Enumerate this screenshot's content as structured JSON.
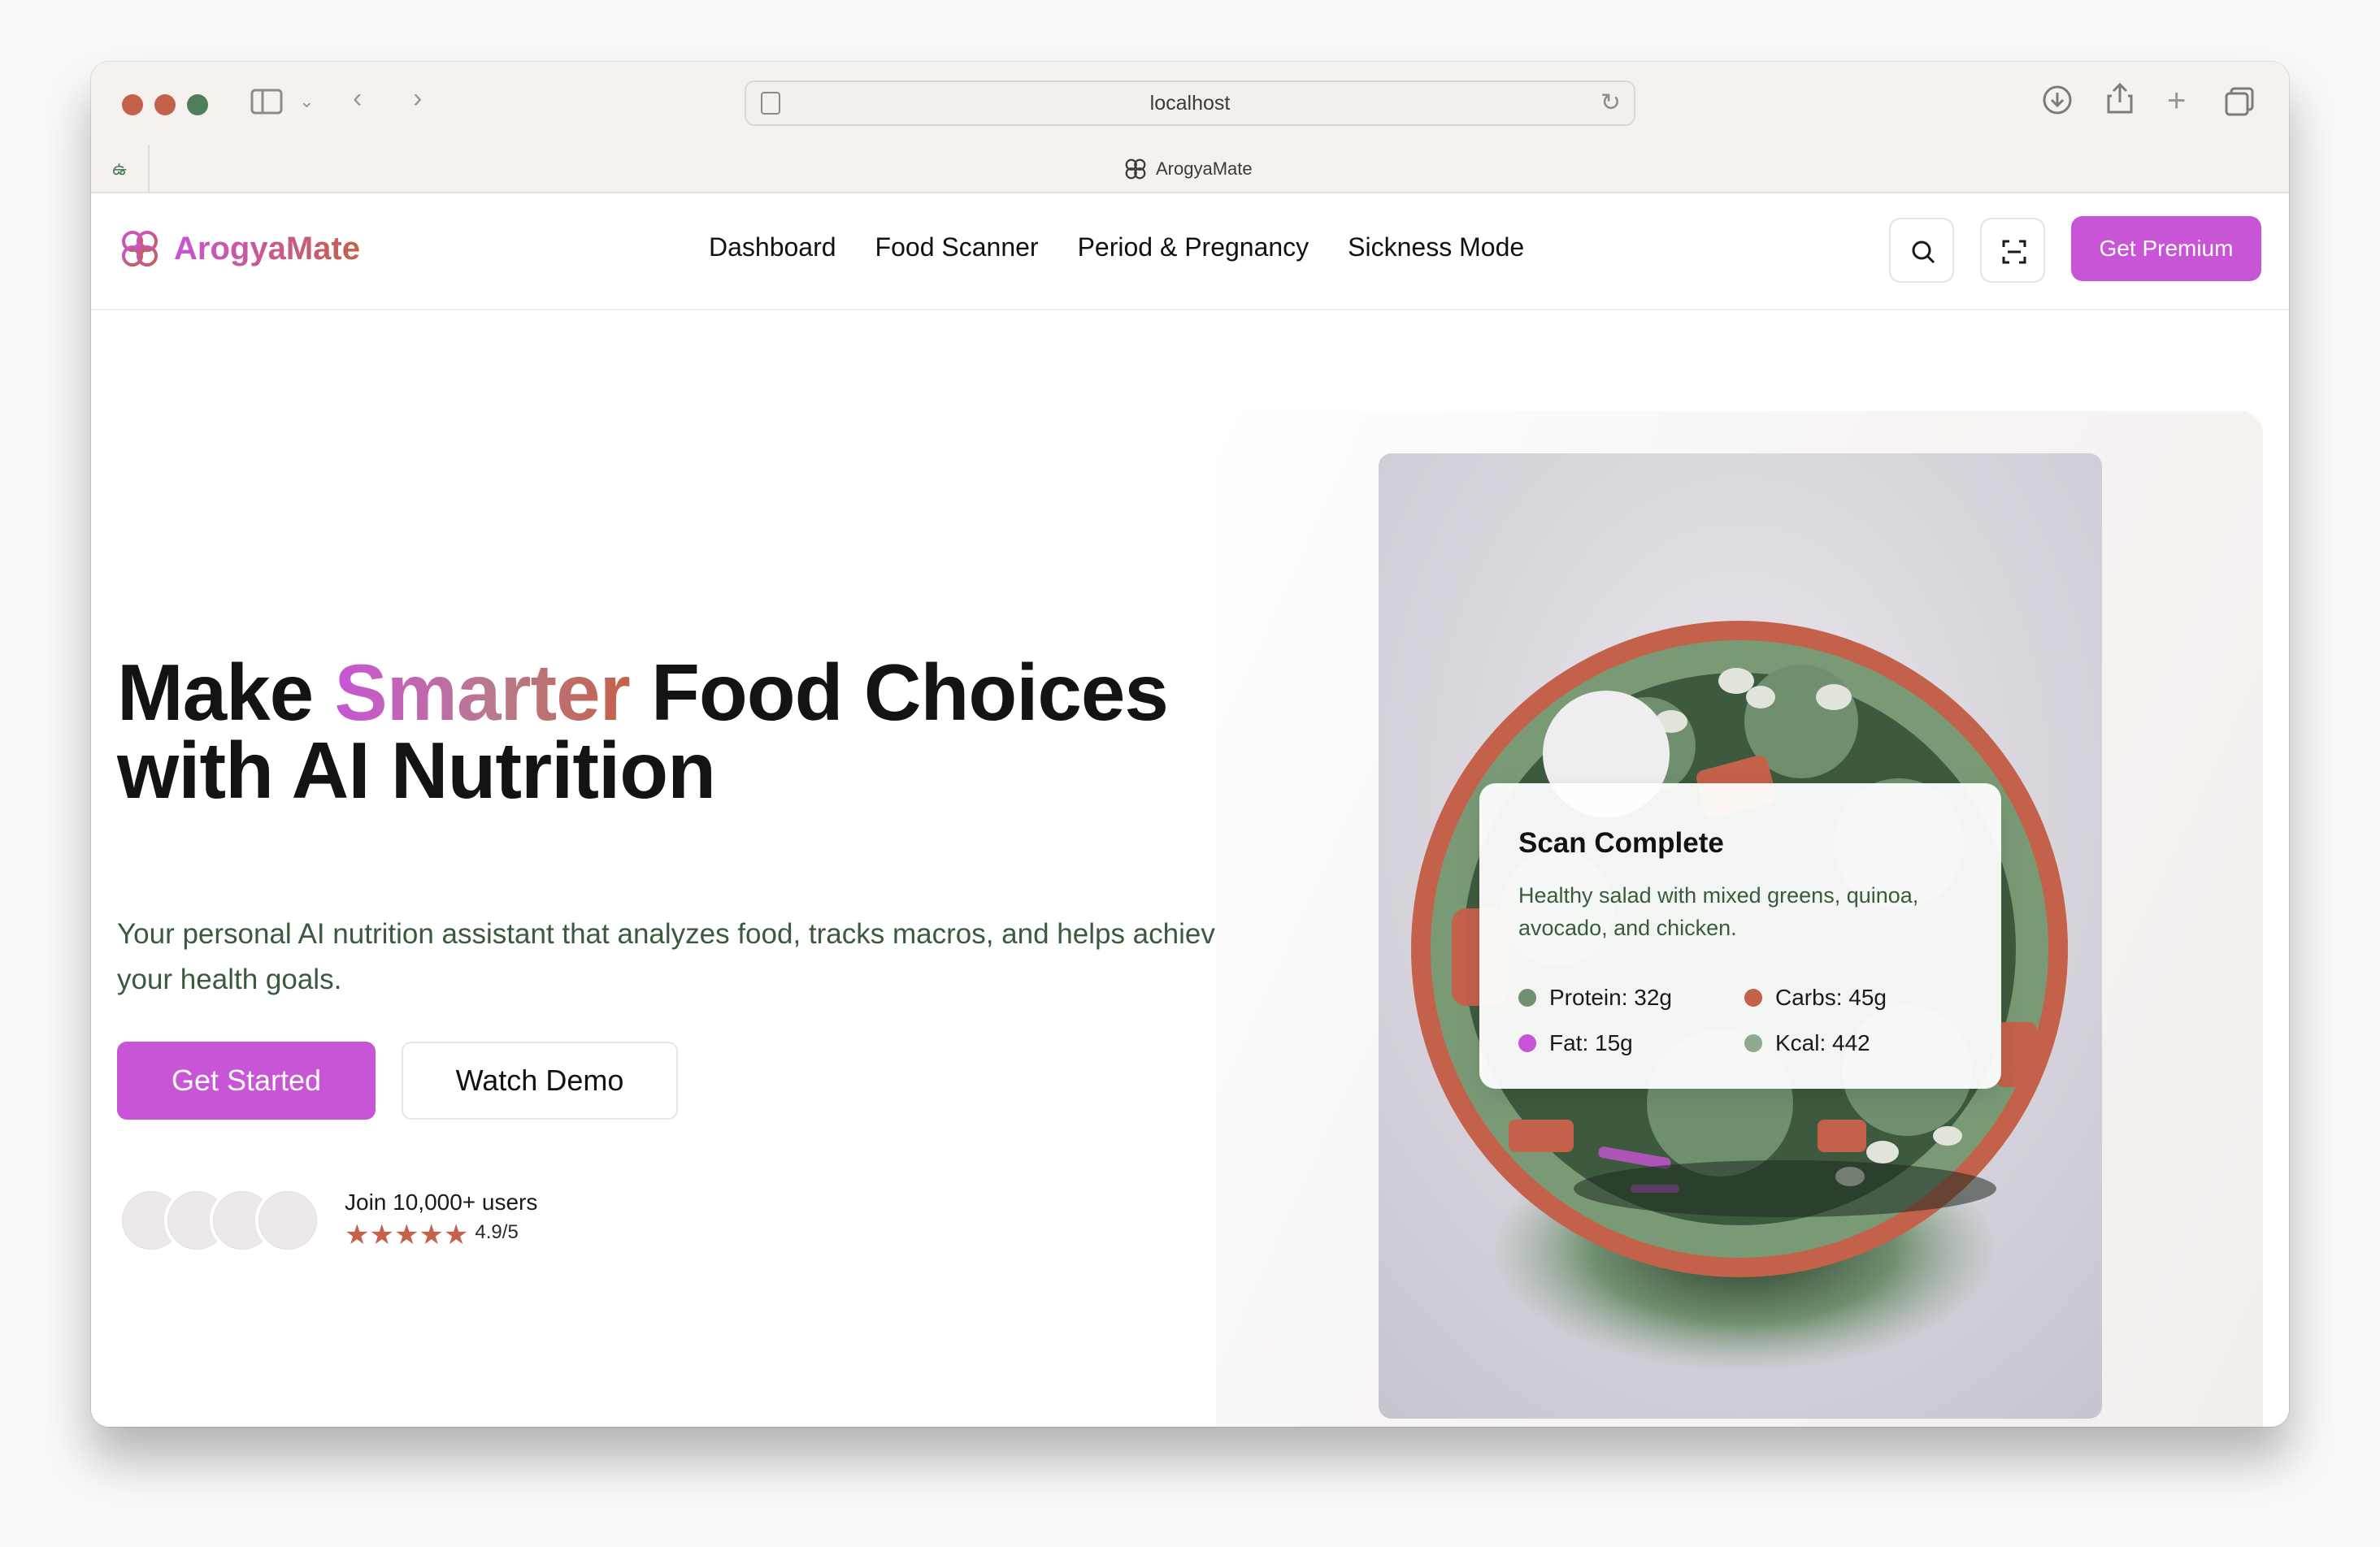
{
  "browser": {
    "url": "localhost",
    "tab_title": "ArogyaMate"
  },
  "header": {
    "brand": "ArogyaMate",
    "nav": [
      "Dashboard",
      "Food Scanner",
      "Period & Pregnancy",
      "Sickness Mode"
    ],
    "premium_label": "Get Premium",
    "icons": [
      "search-icon",
      "scan-icon"
    ]
  },
  "hero": {
    "title_part1": "Make ",
    "title_highlight": "Smarter",
    "title_part2": " Food Choices",
    "title_line2": "with AI Nutrition",
    "subtitle": "Your personal AI nutrition assistant that analyzes food, tracks macros, and helps achieve your health goals.",
    "primary_cta": "Get Started",
    "secondary_cta": "Watch Demo",
    "social_proof": "Join 10,000+ users",
    "rating": "4.9/5",
    "stars": "★★★★★"
  },
  "scan_card": {
    "title": "Scan Complete",
    "description": "Healthy salad with mixed greens, quinoa, avocado, and chicken.",
    "macros": [
      {
        "label": "Protein: 32g",
        "color": "#6f8f6f"
      },
      {
        "label": "Carbs: 45g",
        "color": "#c4614a"
      },
      {
        "label": "Fat: 15g",
        "color": "#c854d6"
      },
      {
        "label": "Kcal: 442",
        "color": "#8fa88f"
      }
    ]
  },
  "colors": {
    "accent": "#c854d6",
    "secondary": "#c4614a",
    "text_green": "#3a5a3e"
  }
}
